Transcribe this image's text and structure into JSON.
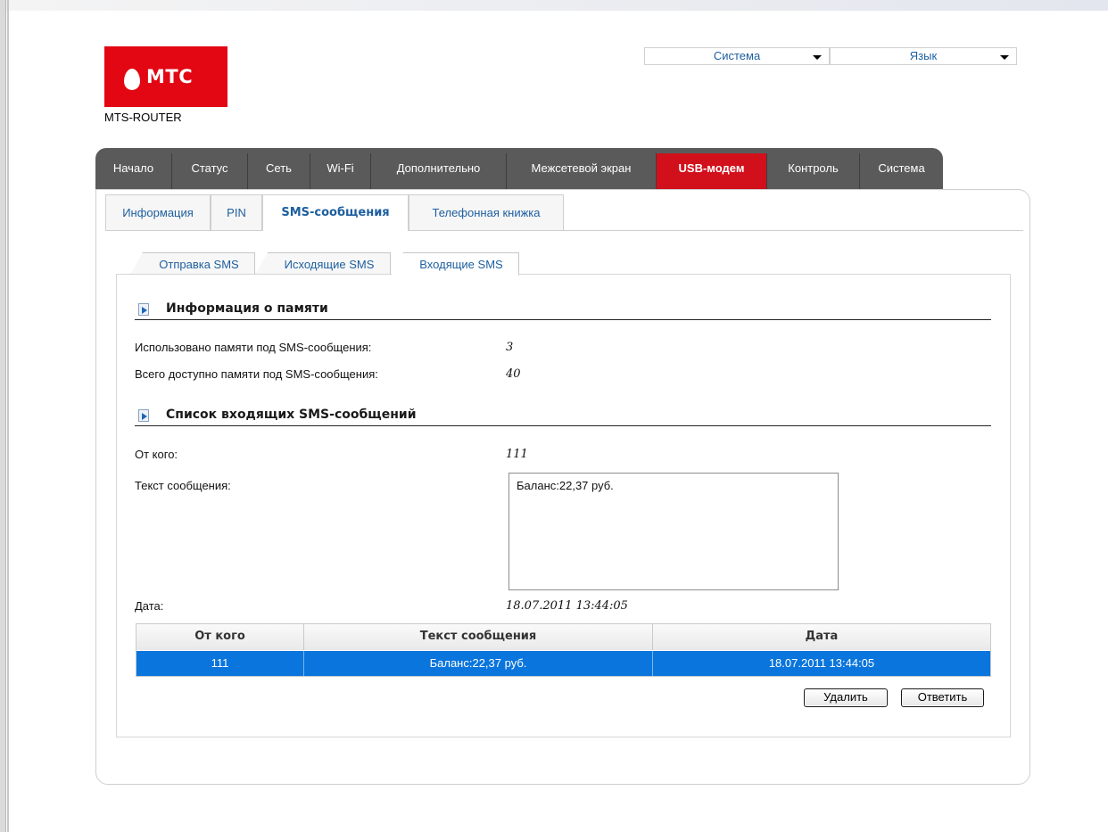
{
  "brand": {
    "logo_text": "МТС",
    "router_name": "MTS-ROUTER"
  },
  "top_selects": {
    "system": "Система",
    "language": "Язык"
  },
  "main_tabs": [
    "Начало",
    "Статус",
    "Сеть",
    "Wi-Fi",
    "Дополнительно",
    "Межсетевой экран",
    "USB-модем",
    "Контроль",
    "Система"
  ],
  "main_tab_active": "USB-модем",
  "sub_tabs": [
    "Информация",
    "PIN",
    "SMS-сообщения",
    "Телефонная книжка"
  ],
  "sub_tab_active": "SMS-сообщения",
  "sms_tabs": [
    "Отправка SMS",
    "Исходящие SMS",
    "Входящие SMS"
  ],
  "sms_tab_active": "Входящие SMS",
  "memory": {
    "title": "Информация о памяти",
    "used_label": "Использовано памяти под SMS-сообщения:",
    "used_value": "3",
    "total_label": "Всего доступно памяти под SMS-сообщения:",
    "total_value": "40"
  },
  "inbox": {
    "title": "Список входящих SMS-сообщений",
    "from_label": "От кого:",
    "from_value": "111",
    "text_label": "Текст сообщения:",
    "text_value": "Баланс:22,37 руб.",
    "date_label": "Дата:",
    "date_value": "18.07.2011 13:44:05"
  },
  "table": {
    "headers": [
      "От кого",
      "Текст сообщения",
      "Дата"
    ],
    "rows": [
      [
        "111",
        "Баланс:22,37 руб.",
        "18.07.2011 13:44:05"
      ]
    ],
    "selected_color": "#0a75dc"
  },
  "buttons": {
    "delete": "Удалить",
    "reply": "Ответить"
  },
  "colors": {
    "brand_red": "#e30613",
    "nav_dark": "#5a5a5a",
    "link_blue": "#1e5fa0"
  }
}
